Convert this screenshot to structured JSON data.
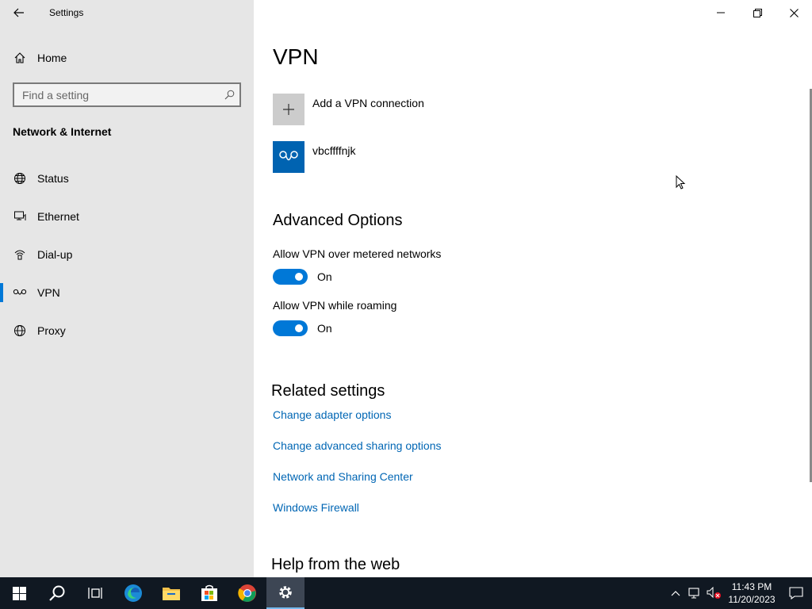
{
  "window": {
    "app_title": "Settings"
  },
  "sidebar": {
    "home_label": "Home",
    "search_placeholder": "Find a setting",
    "section_title": "Network & Internet",
    "items": [
      {
        "label": "Status",
        "icon": "globe-icon"
      },
      {
        "label": "Ethernet",
        "icon": "ethernet-icon"
      },
      {
        "label": "Dial-up",
        "icon": "dialup-icon"
      },
      {
        "label": "VPN",
        "icon": "vpn-icon",
        "active": true
      },
      {
        "label": "Proxy",
        "icon": "globe-icon"
      }
    ]
  },
  "main": {
    "title": "VPN",
    "add_vpn_label": "Add a VPN connection",
    "connection_name": "vbcffffnjk",
    "advanced_heading": "Advanced Options",
    "metered_label": "Allow VPN over metered networks",
    "metered_state": "On",
    "roaming_label": "Allow VPN while roaming",
    "roaming_state": "On",
    "related_heading": "Related settings",
    "links": [
      "Change adapter options",
      "Change advanced sharing options",
      "Network and Sharing Center",
      "Windows Firewall"
    ],
    "help_heading": "Help from the web"
  },
  "taskbar": {
    "time": "11:43 PM",
    "date": "11/20/2023"
  },
  "colors": {
    "accent": "#0078d7",
    "link": "#0066b4",
    "sidebar_bg": "#e6e6e6",
    "taskbar_bg": "#101822"
  }
}
